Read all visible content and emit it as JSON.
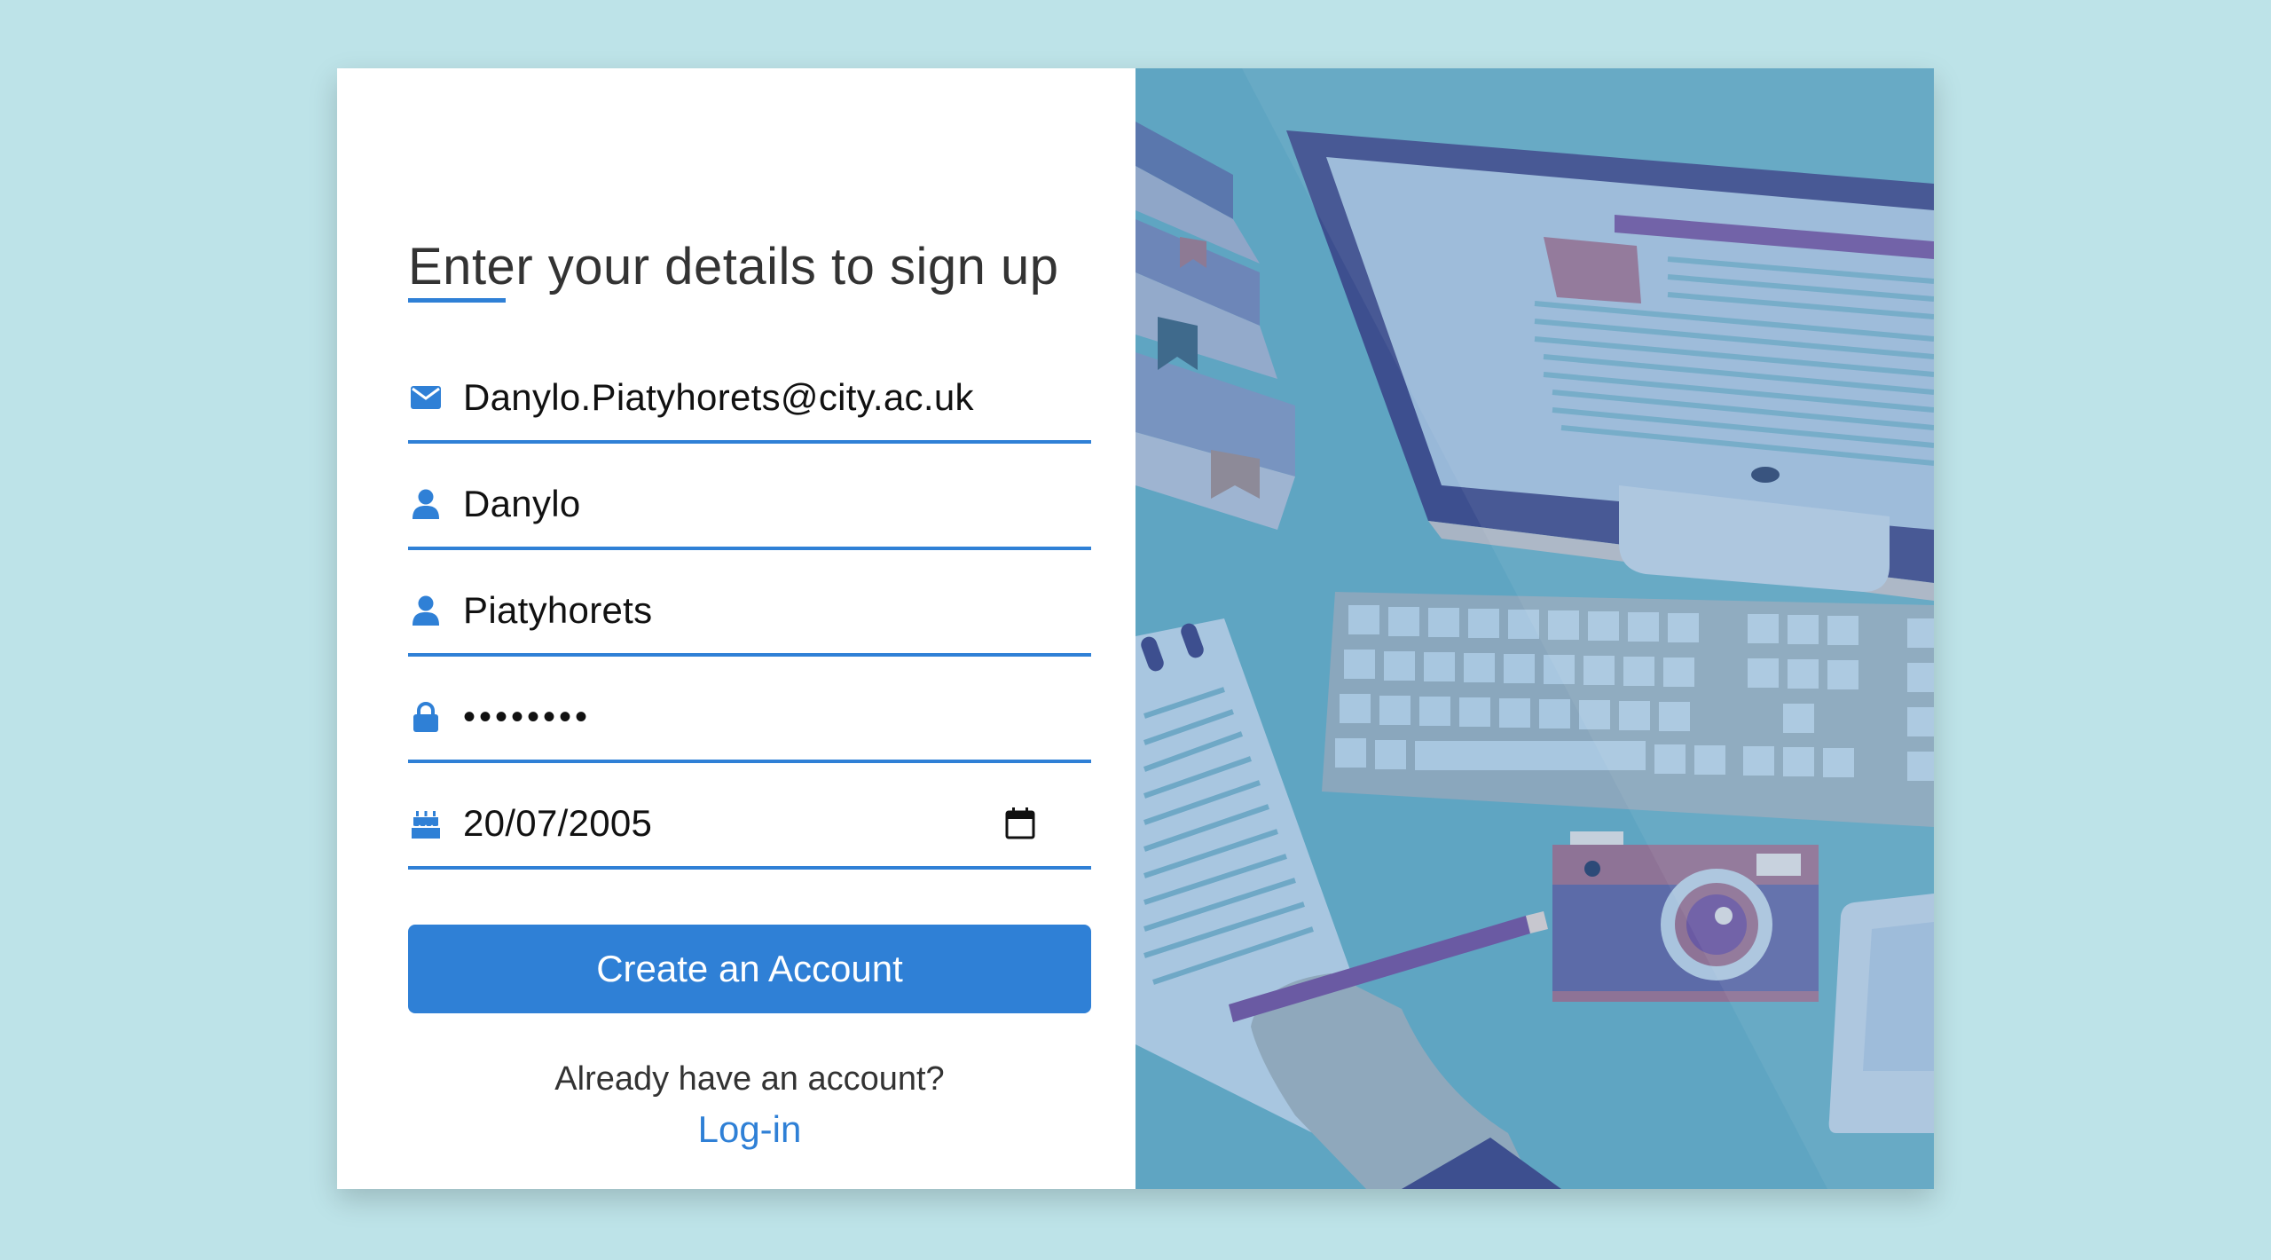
{
  "form": {
    "title": "Enter your details to sign up",
    "fields": {
      "email": {
        "value": "Danylo.Piatyhorets@city.ac.uk",
        "icon": "envelope-icon"
      },
      "first_name": {
        "value": "Danylo",
        "icon": "user-icon"
      },
      "last_name": {
        "value": "Piatyhorets",
        "icon": "user-icon"
      },
      "password": {
        "value": "••••••••",
        "icon": "lock-icon"
      },
      "birthdate": {
        "value": "20/07/2005",
        "icon": "birthday-cake-icon",
        "picker_icon": "calendar-icon"
      }
    },
    "submit_label": "Create an Account",
    "already_text": "Already have an account?",
    "login_label": "Log-in"
  },
  "colors": {
    "accent": "#2f80d6",
    "background": "#bde3e8",
    "illustration_bg": "#5fa5c2"
  }
}
